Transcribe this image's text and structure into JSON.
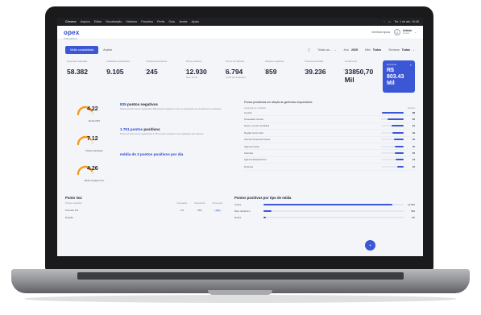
{
  "menubar": {
    "apple": "",
    "items": [
      "Chrome",
      "Arquivo",
      "Editar",
      "Visualização",
      "Histórico",
      "Favoritos",
      "Perfis",
      "Guia",
      "Janela",
      "Ajuda"
    ],
    "clock": "Ter. 1 de abr. 10:45"
  },
  "header": {
    "logo": "opex",
    "logo_sub": "INTELIGÊNCIA",
    "link": "Interface Ajuda",
    "user_name": "Admin",
    "user_role": "Gestor"
  },
  "toolbar": {
    "tabs": [
      {
        "label": "Visão consolidada",
        "active": true
      },
      {
        "label": "Avaliar",
        "active": false
      }
    ],
    "filters": [
      {
        "label": "Todas as...",
        "value": ""
      },
      {
        "label": "Ano",
        "value": "2025"
      },
      {
        "label": "Mês",
        "value": "Todos"
      },
      {
        "label": "Semana",
        "value": "Todas"
      }
    ]
  },
  "kpis": [
    {
      "label": "Pesquisas realizadas",
      "value": "58.382",
      "sub": ""
    },
    {
      "label": "Avaliações pesquisadas",
      "value": "9.105",
      "sub": ""
    },
    {
      "label": "Pesquisas pendentes",
      "value": "245",
      "sub": ""
    },
    {
      "label": "Pontos positivos",
      "value": "12.930",
      "sub": "Taxa: 22,1%"
    },
    {
      "label": "Pontos de melhoria",
      "value": "6.794",
      "sub": "11,6% das avaliações"
    },
    {
      "label": "Reações negativas",
      "value": "859",
      "sub": ""
    },
    {
      "label": "Pessoas atendidas",
      "value": "39.236",
      "sub": ""
    },
    {
      "label": "Investimento",
      "value": "33850,70 Mil",
      "sub": ""
    }
  ],
  "kpi_highlight": {
    "label": "Economia",
    "value": "R$ 803.43 Mil",
    "close": "×"
  },
  "gauges": [
    {
      "value": "4.22",
      "label": "Média NPS",
      "level": 0.84
    },
    {
      "value": "7.12",
      "label": "Média satisfação",
      "level": 0.71
    },
    {
      "value": "4.26",
      "label": "Média engajamento",
      "level": 0.85
    }
  ],
  "insights": [
    {
      "title_a": "835",
      "title_b": "pontos negativos",
      "text": "Neste período foram registrados 835 pontos negativos entre as avaliações de atendimento coletadas."
    },
    {
      "title_a": "1.751 pontos",
      "title_b": "positivos",
      "text": "Neste período foram registrados 1.751 pontos positivos nas avaliações dos clientes."
    },
    {
      "title_a": "média de 2 pontos positivos por dia",
      "title_b": "",
      "text": ""
    }
  ],
  "ranking": {
    "title": "Pontos percebidos em relação às gerências responsáveis",
    "col_left": "Gerência por unidade",
    "col_right": "Pontos",
    "rows": [
      {
        "name": "Central",
        "value": "38",
        "level": 0.95
      },
      {
        "name": "Sociedade Central",
        "value": "25",
        "level": 0.7
      },
      {
        "name": "Norte e Centro do Brasil",
        "value": "21",
        "level": 0.55
      },
      {
        "name": "Região Centro-Sul",
        "value": "19",
        "level": 0.5
      },
      {
        "name": "Clientes Pessoas Físicas",
        "value": "16",
        "level": 0.42
      },
      {
        "name": "Agência Oeste",
        "value": "15",
        "level": 0.4
      },
      {
        "name": "Ciências",
        "value": "15",
        "level": 0.38
      },
      {
        "name": "Agência Estadual Sul",
        "value": "14",
        "level": 0.35
      },
      {
        "name": "Diretoria",
        "value": "12",
        "level": 0.3
      }
    ]
  },
  "pv": {
    "title": "Ponto Voz",
    "head_first": "Pontos indicados",
    "head_cols": [
      "Pontuação",
      "Relevância",
      "Percepção"
    ],
    "rows": [
      {
        "name": "Pontuais 0%",
        "a": "1%",
        "b": "56%",
        "c": "+8%"
      },
      {
        "name": "Reação",
        "a": "",
        "b": "",
        "c": ""
      }
    ]
  },
  "tipo": {
    "title": "Pontos positivos por tipo de mídia",
    "rows": [
      {
        "name": "Online",
        "value": "12.510",
        "level": 0.92
      },
      {
        "name": "Meio telefônico",
        "value": "546",
        "level": 0.06
      },
      {
        "name": "Redes",
        "value": "2%",
        "level": 0.02
      }
    ]
  },
  "fab": "+"
}
